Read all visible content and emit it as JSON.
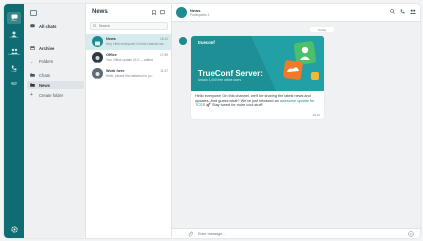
{
  "rail": {
    "items": [
      {
        "label": "Chats",
        "icon": "chat-icon"
      },
      {
        "label": "Contacts",
        "icon": "contacts-icon"
      },
      {
        "label": "Conferences",
        "icon": "conference-icon"
      },
      {
        "label": "Calls",
        "icon": "calls-icon"
      },
      {
        "label": "More",
        "icon": "more-icon"
      }
    ],
    "settings_icon": "gear-icon"
  },
  "folders": {
    "items": [
      {
        "label": "All chats",
        "icon": "chats-icon"
      },
      {
        "label": "Archive",
        "icon": "archive-icon"
      },
      {
        "label": "Folders",
        "icon": "chevron-icon"
      },
      {
        "label": "Chats",
        "icon": "folder-icon"
      },
      {
        "label": "News",
        "icon": "folder-icon"
      },
      {
        "label": "Create folder",
        "icon": "plus-icon"
      }
    ]
  },
  "list": {
    "title": "News",
    "search_placeholder": "Search",
    "chats": [
      {
        "name": "News",
        "time": "18:12",
        "preview": "Hey, Hello everyone! On this channel we..."
      },
      {
        "name": "Office",
        "time": "17:59",
        "preview": "You: Office update v2.0 — added"
      },
      {
        "name": "Work here",
        "time": "11:37",
        "preview": "Hello, please find attached to yo..."
      }
    ]
  },
  "conversation": {
    "title": "News",
    "subtitle": "Participants 1",
    "date": "Today",
    "banner_brand": "trueconf",
    "banner_title": "TrueConf Server:",
    "banner_sub": "Unlock 1,000 free online users",
    "message_text": "Hello everyone! On this channel, we'll be sharing the latest news and updates. And guess what? We've just released an",
    "message_link": "awesome update for TCSS",
    "message_tail": "🚀 Stay tuned for more cool stuff!",
    "message_time": "18:12",
    "composer_placeholder": "Enter message..."
  },
  "colors": {
    "brand": "#0e6c72",
    "accent": "#1f8a8f",
    "active_row": "#d6ecec"
  }
}
